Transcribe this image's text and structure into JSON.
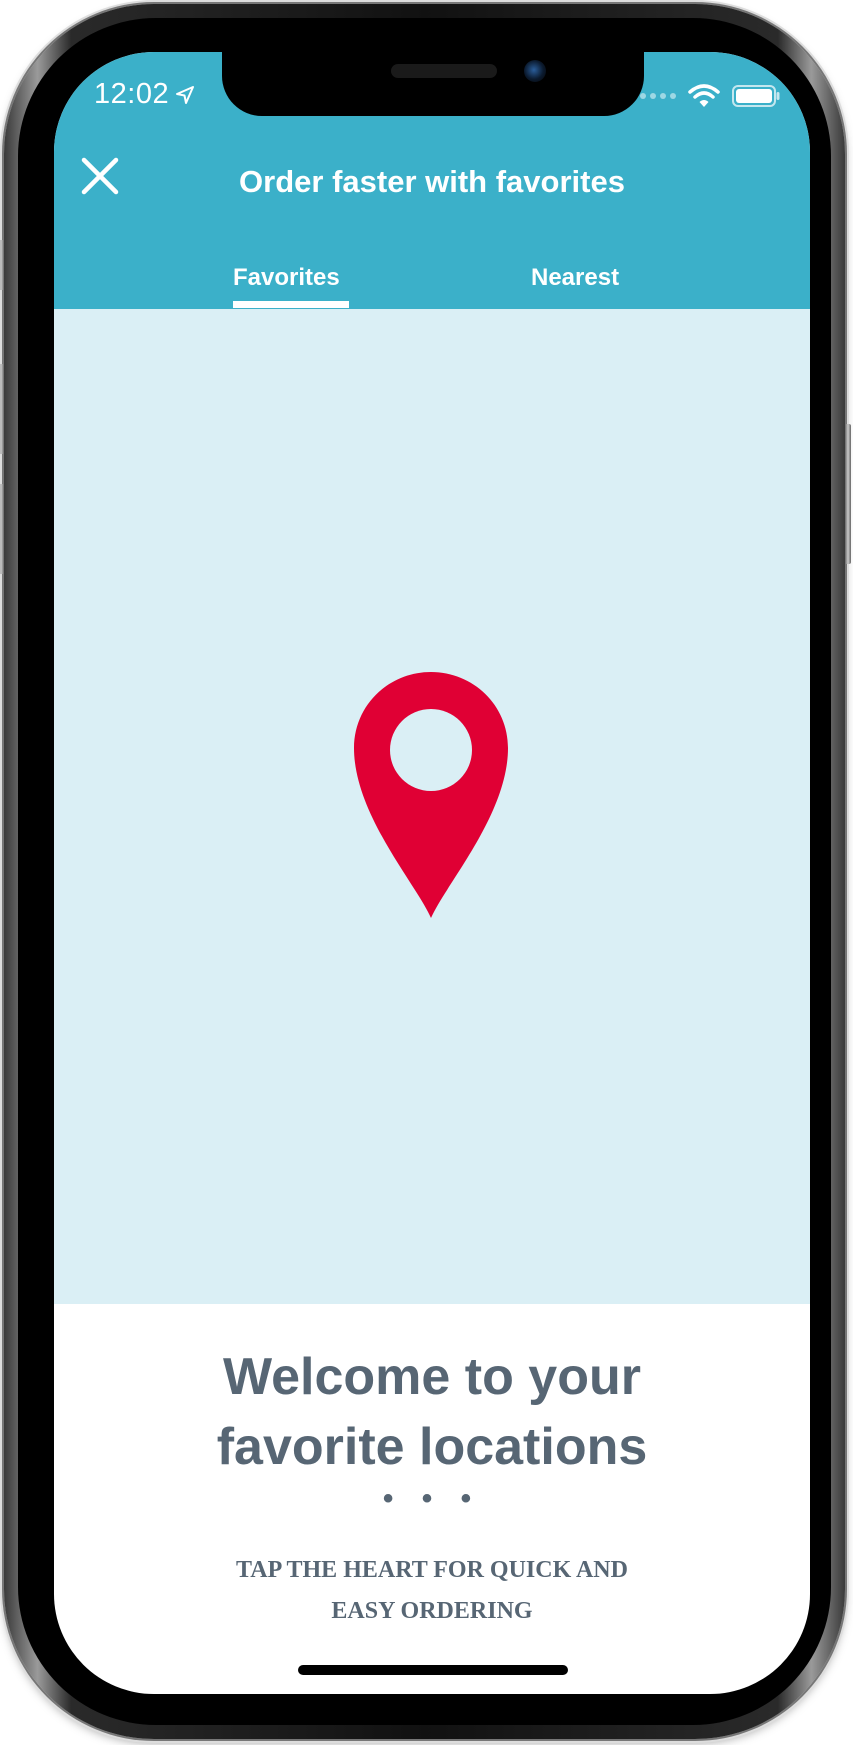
{
  "status_bar": {
    "time": "12:02",
    "location_icon": "location-arrow-icon",
    "wifi_icon": "wifi-icon",
    "battery_icon": "battery-icon"
  },
  "header": {
    "title": "Order faster with favorites",
    "close_icon": "close-icon",
    "background_color": "#3bb0c9"
  },
  "tabs": [
    {
      "label": "Favorites",
      "selected": true
    },
    {
      "label": "Nearest",
      "selected": false
    }
  ],
  "map": {
    "background_color": "#daeff5",
    "pin_icon": "map-pin-icon",
    "pin_color": "#e00034"
  },
  "welcome": {
    "title_line1": "Welcome to your",
    "title_line2": "favorite locations",
    "separator": "• • •",
    "subtitle_line1": "TAP THE HEART FOR QUICK AND",
    "subtitle_line2": "EASY ORDERING"
  }
}
